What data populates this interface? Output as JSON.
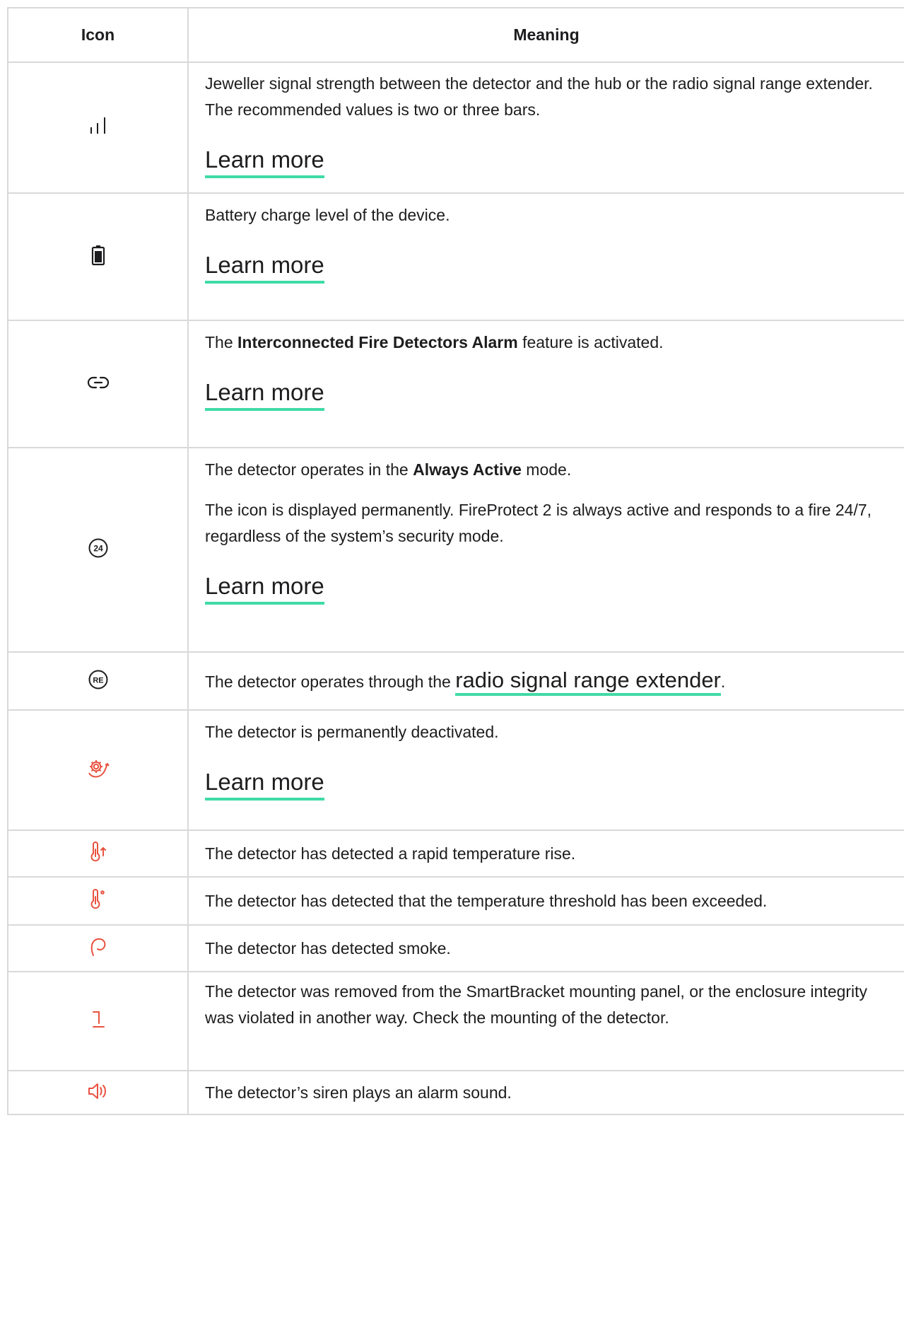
{
  "headers": {
    "icon": "Icon",
    "meaning": "Meaning"
  },
  "colors": {
    "accent_underline": "#3fdba5",
    "alert_red": "#e8523f",
    "border": "#d9d9d9"
  },
  "rows": [
    {
      "icon": "signal-strength-icon",
      "text": "Jeweller signal strength between the detector and the hub or the radio signal range extender. The recommended values is two or three bars.",
      "link": "Learn more"
    },
    {
      "icon": "battery-icon",
      "text": "Battery charge level of the device.",
      "link": "Learn more"
    },
    {
      "icon": "link-icon",
      "text_before": "The ",
      "bold": "Interconnected Fire Detectors Alarm",
      "text_after": " feature is activated.",
      "link": "Learn more"
    },
    {
      "icon": "always-active-24-icon",
      "text_before": "The detector operates in the ",
      "bold": "Always Active",
      "text_after": " mode.",
      "text2": "The icon is displayed permanently. FireProtect 2 is always active and responds to a fire 24/7, regardless of the system’s security mode.",
      "link": "Learn more"
    },
    {
      "icon": "range-extender-re-icon",
      "text_before": "The detector operates through the ",
      "link": "radio signal range extender",
      "text_after": "."
    },
    {
      "icon": "deactivated-gear-icon",
      "text": "The detector is permanently deactivated.",
      "link": "Learn more"
    },
    {
      "icon": "temperature-rise-icon",
      "text": "The detector has detected a rapid temperature rise."
    },
    {
      "icon": "temperature-threshold-icon",
      "text": "The detector has detected that the temperature threshold has been exceeded."
    },
    {
      "icon": "smoke-icon",
      "text": "The detector has detected smoke."
    },
    {
      "icon": "tamper-icon",
      "text": "The detector was removed from the SmartBracket mounting panel, or the enclosure integrity was violated in another way. Check the mounting of the detector."
    },
    {
      "icon": "siren-speaker-icon",
      "text": "The detector’s siren plays an alarm sound."
    }
  ]
}
